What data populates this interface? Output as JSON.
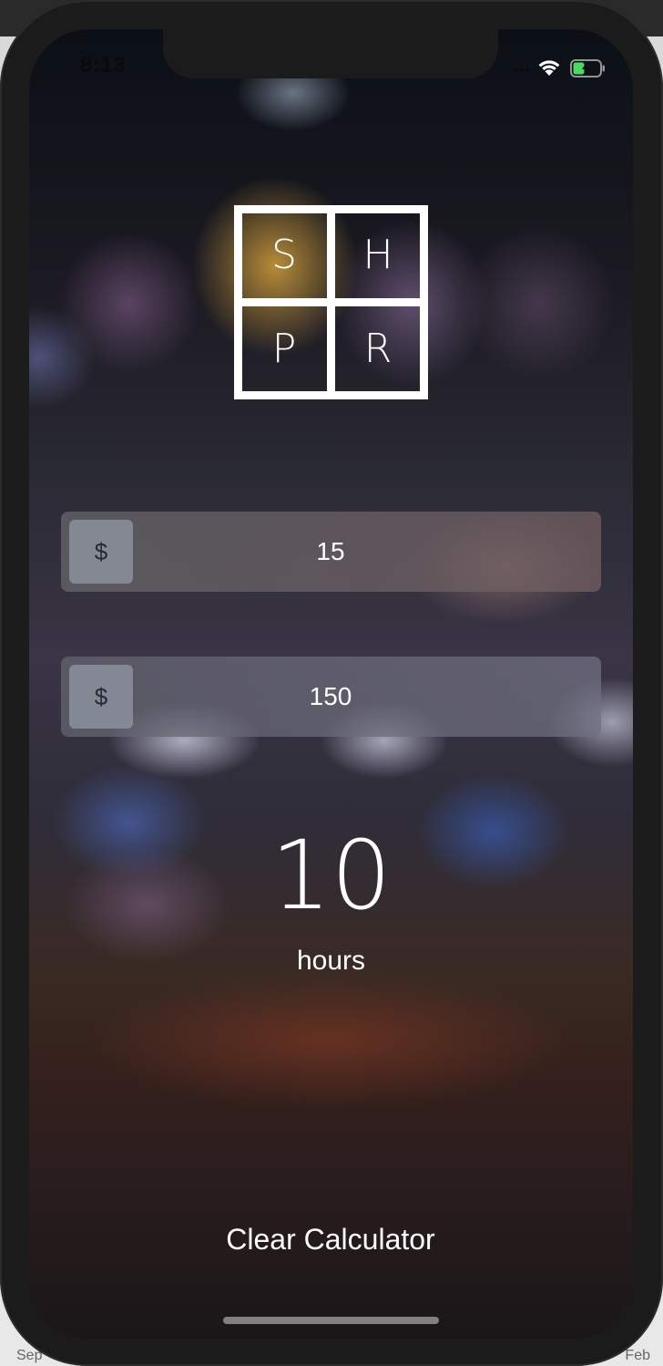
{
  "host": {
    "left_label": "Sep",
    "right_label": "Feb"
  },
  "status_bar": {
    "time": "8:13",
    "wifi_icon": "wifi-icon",
    "signal_icon": "cellular-signal-icon",
    "battery_icon": "battery-charging-icon",
    "battery_color": "#4cd964"
  },
  "logo": {
    "letters": [
      "S",
      "H",
      "P",
      "R"
    ]
  },
  "inputs": [
    {
      "currency_symbol": "$",
      "value": "15"
    },
    {
      "currency_symbol": "$",
      "value": "150"
    }
  ],
  "result": {
    "value": "10",
    "unit": "hours"
  },
  "actions": {
    "clear_label": "Clear Calculator"
  }
}
